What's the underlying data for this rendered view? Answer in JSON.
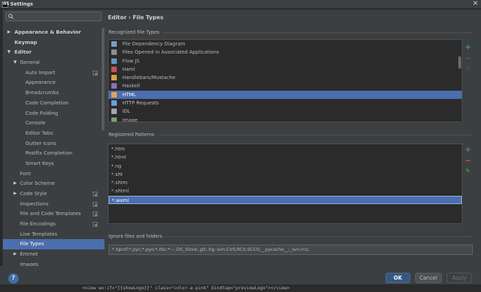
{
  "window": {
    "title": "Settings",
    "app_icon": "WS",
    "close_glyph": "✕"
  },
  "search": {
    "placeholder": "",
    "value": ""
  },
  "tree": [
    {
      "label": "Appearance & Behavior",
      "level": 0,
      "arrow": "▶",
      "bold": true
    },
    {
      "label": "Keymap",
      "level": 0,
      "arrow": "",
      "bold": true
    },
    {
      "label": "Editor",
      "level": 0,
      "arrow": "▼",
      "bold": true
    },
    {
      "label": "General",
      "level": 1,
      "arrow": "▼"
    },
    {
      "label": "Auto Import",
      "level": 2,
      "arrow": "",
      "project": true
    },
    {
      "label": "Appearance",
      "level": 2,
      "arrow": ""
    },
    {
      "label": "Breadcrumbs",
      "level": 2,
      "arrow": ""
    },
    {
      "label": "Code Completion",
      "level": 2,
      "arrow": ""
    },
    {
      "label": "Code Folding",
      "level": 2,
      "arrow": ""
    },
    {
      "label": "Console",
      "level": 2,
      "arrow": ""
    },
    {
      "label": "Editor Tabs",
      "level": 2,
      "arrow": ""
    },
    {
      "label": "Gutter Icons",
      "level": 2,
      "arrow": ""
    },
    {
      "label": "Postfix Completion",
      "level": 2,
      "arrow": ""
    },
    {
      "label": "Smart Keys",
      "level": 2,
      "arrow": ""
    },
    {
      "label": "Font",
      "level": 1,
      "arrow": ""
    },
    {
      "label": "Color Scheme",
      "level": 1,
      "arrow": "▶"
    },
    {
      "label": "Code Style",
      "level": 1,
      "arrow": "▶",
      "project": true
    },
    {
      "label": "Inspections",
      "level": 1,
      "arrow": "",
      "project": true
    },
    {
      "label": "File and Code Templates",
      "level": 1,
      "arrow": "",
      "project": true
    },
    {
      "label": "File Encodings",
      "level": 1,
      "arrow": "",
      "project": true
    },
    {
      "label": "Live Templates",
      "level": 1,
      "arrow": ""
    },
    {
      "label": "File Types",
      "level": 1,
      "arrow": "",
      "selected": true
    },
    {
      "label": "Emmet",
      "level": 1,
      "arrow": "▶"
    },
    {
      "label": "Images",
      "level": 1,
      "arrow": ""
    }
  ],
  "main": {
    "breadcrumb": "Editor › File Types",
    "recognized_label": "Recognized File Types",
    "file_types": [
      {
        "label": "File Dependency Diagram",
        "icon": "diagram-icon",
        "color": "#7a9ec2"
      },
      {
        "label": "Files Opened in Associated Applications",
        "icon": "external-app-icon",
        "color": "#8c8c8c"
      },
      {
        "label": "Flow JS",
        "icon": "flow-icon",
        "color": "#6897bb"
      },
      {
        "label": "Haml",
        "icon": "haml-icon",
        "color": "#c75450"
      },
      {
        "label": "Handlebars/Mustache",
        "icon": "handlebars-icon",
        "color": "#d9a343"
      },
      {
        "label": "Haskell",
        "icon": "haskell-icon",
        "color": "#8e6fb8"
      },
      {
        "label": "HTML",
        "icon": "html-icon",
        "color": "#e8a05c",
        "selected": true
      },
      {
        "label": "HTTP Requests",
        "icon": "http-icon",
        "color": "#6aa0d8"
      },
      {
        "label": "IDL",
        "icon": "idl-icon",
        "color": "#9aa7b0"
      },
      {
        "label": "Image",
        "icon": "image-icon",
        "color": "#7aa36f"
      }
    ],
    "patterns_label": "Registered Patterns",
    "patterns": [
      {
        "label": "*.htm"
      },
      {
        "label": "*.html"
      },
      {
        "label": "*.ng"
      },
      {
        "label": "*.sht"
      },
      {
        "label": "*.shtm"
      },
      {
        "label": "*.shtml"
      },
      {
        "label": "*.wxml",
        "selected": true
      }
    ],
    "ignore_label": "Ignore files and folders",
    "ignore_value": "*.hprof;*.pyc;*.pyo;*.rbc;*~;.DS_Store;.git;.hg;.svn;CVS;RCS;SCCS;__pycache__;_svn;rcs;"
  },
  "buttons": {
    "ok": "OK",
    "cancel": "Cancel",
    "apply": "Apply",
    "help": "?"
  },
  "glyphs": {
    "add": "+",
    "remove": "−",
    "edit": "✎"
  },
  "background_code": {
    "a": "<view wx:if=\"{{showLogo}}\" class=\"color-a-pink\" bindtap=\"previewLogo\"></view>"
  }
}
